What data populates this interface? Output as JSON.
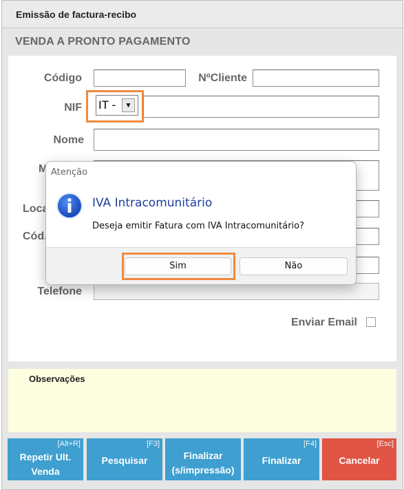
{
  "window": {
    "title": "Emissão de factura-recibo"
  },
  "section": {
    "title": "VENDA A PRONTO PAGAMENTO"
  },
  "form": {
    "codigo_label": "Código",
    "ncliente_label": "NºCliente",
    "nif_label": "NIF",
    "nif_country": "IT -",
    "nome_label": "Nome",
    "morada_label_partial": "M",
    "localidade_label_partial": "Loca",
    "cod_postal_label_partial": "Cód.",
    "telefone_label": "Telefone",
    "enviar_email_label": "Enviar Email"
  },
  "observacoes": {
    "label": "Observações"
  },
  "buttons": [
    {
      "shortcut": "[Alt+R]",
      "label": "Repetir Ult. Venda"
    },
    {
      "shortcut": "[F3]",
      "label": "Pesquisar"
    },
    {
      "shortcut": "",
      "label": "Finalizar (s/impressão)"
    },
    {
      "shortcut": "[F4]",
      "label": "Finalizar"
    },
    {
      "shortcut": "[Esc]",
      "label": "Cancelar"
    }
  ],
  "dialog": {
    "title": "Atenção",
    "icon": "info-icon",
    "heading": "IVA Intracomunitário",
    "message": "Deseja emitir Fatura com IVA Intracomunitário?",
    "yes_label": "Sim",
    "no_label": "Não"
  },
  "colors": {
    "accent_blue": "#3e9fd0",
    "cancel_red": "#e05545",
    "highlight_orange": "#f0893c",
    "observacoes_bg": "#fdfde0"
  }
}
